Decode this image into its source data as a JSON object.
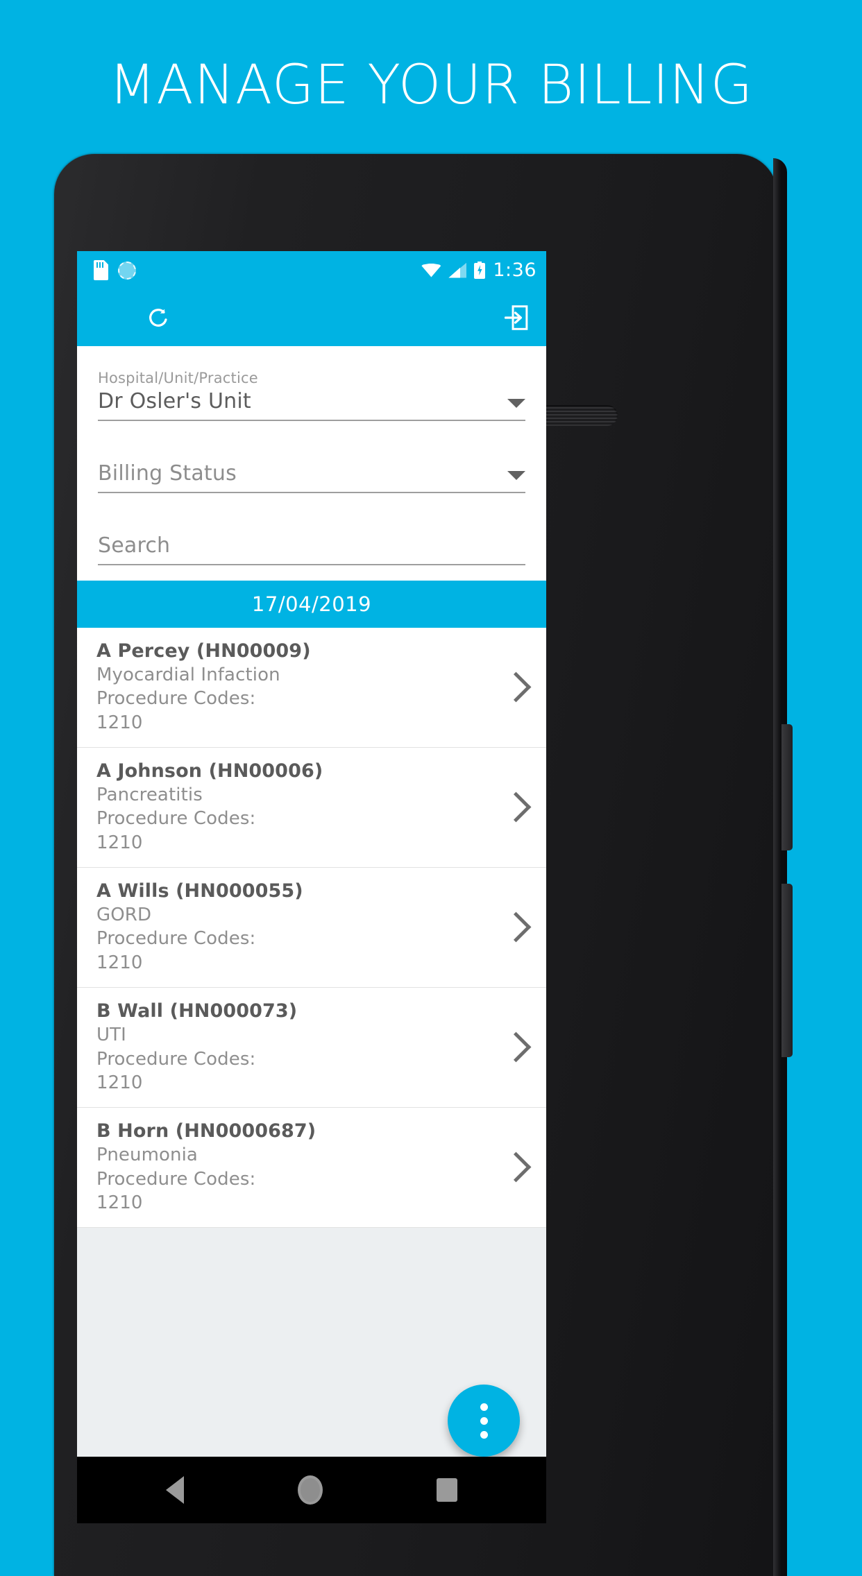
{
  "promo": {
    "headline": "MANAGE YOUR BILLING",
    "background_color": "#00b3e3"
  },
  "statusbar": {
    "left_icons": [
      "sd-card-icon",
      "sync-icon"
    ],
    "right_icons": [
      "wifi-icon",
      "cellular-signal-icon",
      "battery-charging-icon"
    ],
    "time": "1:36"
  },
  "toolbar": {
    "menu_icon": "hamburger-menu-icon",
    "refresh_icon": "refresh-icon",
    "logout_icon": "logout-icon",
    "background_color": "#00b3e3"
  },
  "filters": {
    "unit": {
      "label": "Hospital/Unit/Practice",
      "value": "Dr Osler's Unit"
    },
    "billing_status": {
      "label": "",
      "placeholder": "Billing Status",
      "value": ""
    },
    "search": {
      "label": "",
      "placeholder": "Search",
      "value": ""
    }
  },
  "list": {
    "date_header": "17/04/2019",
    "procedure_codes_label": "Procedure Codes:",
    "records": [
      {
        "name": "A Percey (HN00009)",
        "diagnosis": "Myocardial Infaction",
        "codes_label": "Procedure Codes:",
        "codes": "1210"
      },
      {
        "name": "A Johnson (HN00006)",
        "diagnosis": "Pancreatitis",
        "codes_label": "Procedure Codes:",
        "codes": "1210"
      },
      {
        "name": "A Wills (HN000055)",
        "diagnosis": "GORD",
        "codes_label": "Procedure Codes:",
        "codes": "1210"
      },
      {
        "name": "B Wall (HN000073)",
        "diagnosis": "UTI",
        "codes_label": "Procedure Codes:",
        "codes": "1210"
      },
      {
        "name": "B Horn (HN0000687)",
        "diagnosis": "Pneumonia",
        "codes_label": "Procedure Codes:",
        "codes": "1210"
      }
    ]
  },
  "fab": {
    "icon": "more-vert-icon",
    "color": "#00b3e3"
  },
  "navbar": {
    "back": "back-icon",
    "home": "home-icon",
    "recents": "recents-icon"
  }
}
